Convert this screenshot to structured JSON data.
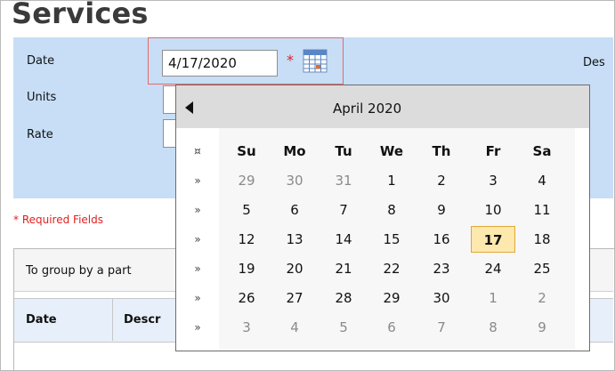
{
  "page": {
    "title": "Services"
  },
  "form": {
    "date_label": "Date",
    "units_label": "Units",
    "rate_label": "Rate",
    "description_label": "Des",
    "date_value": "4/17/2020",
    "required_star": "*",
    "required_note": "* Required Fields"
  },
  "grid": {
    "group_hint": "To group by a part",
    "columns": [
      "Date",
      "Descr"
    ]
  },
  "calendar": {
    "month_label": "April 2020",
    "weekday_headers": [
      "Su",
      "Mo",
      "Tu",
      "We",
      "Th",
      "Fr",
      "Sa"
    ],
    "week_markers": [
      "¤",
      "»",
      "»",
      "»",
      "»",
      "»",
      "»"
    ],
    "selected_day": "17",
    "weeks": [
      [
        {
          "d": "29",
          "other": true
        },
        {
          "d": "30",
          "other": true
        },
        {
          "d": "31",
          "other": true
        },
        {
          "d": "1"
        },
        {
          "d": "2"
        },
        {
          "d": "3"
        },
        {
          "d": "4"
        }
      ],
      [
        {
          "d": "5"
        },
        {
          "d": "6"
        },
        {
          "d": "7"
        },
        {
          "d": "8"
        },
        {
          "d": "9"
        },
        {
          "d": "10"
        },
        {
          "d": "11"
        }
      ],
      [
        {
          "d": "12"
        },
        {
          "d": "13"
        },
        {
          "d": "14"
        },
        {
          "d": "15"
        },
        {
          "d": "16"
        },
        {
          "d": "17",
          "selected": true
        },
        {
          "d": "18"
        }
      ],
      [
        {
          "d": "19"
        },
        {
          "d": "20"
        },
        {
          "d": "21"
        },
        {
          "d": "22"
        },
        {
          "d": "23"
        },
        {
          "d": "24"
        },
        {
          "d": "25"
        }
      ],
      [
        {
          "d": "26"
        },
        {
          "d": "27"
        },
        {
          "d": "28"
        },
        {
          "d": "29"
        },
        {
          "d": "30"
        },
        {
          "d": "1",
          "other": true
        },
        {
          "d": "2",
          "other": true
        }
      ],
      [
        {
          "d": "3",
          "other": true
        },
        {
          "d": "4",
          "other": true
        },
        {
          "d": "5",
          "other": true
        },
        {
          "d": "6",
          "other": true
        },
        {
          "d": "7",
          "other": true
        },
        {
          "d": "8",
          "other": true
        },
        {
          "d": "9",
          "other": true
        }
      ]
    ],
    "icons": {
      "prev": "triangle-left-icon",
      "picker": "calendar-icon"
    }
  },
  "colors": {
    "form_panel": "#c7def6",
    "highlight_border": "#e46a6a",
    "required": "#e02020",
    "today_bg": "#fde8ad"
  }
}
